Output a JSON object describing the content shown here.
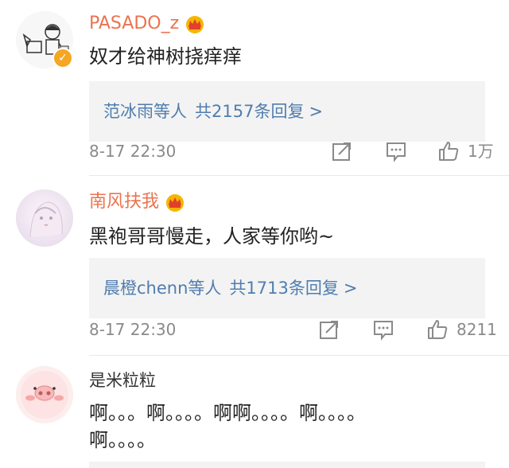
{
  "comments": [
    {
      "username": "PASADO_z",
      "text": "奴才给神树挠痒痒",
      "replies": {
        "people": "范冰雨等人",
        "count": "共2157条回复",
        "chevron": ">"
      },
      "time": "8-17 22:30",
      "likes": "1万"
    },
    {
      "username": "南风扶我",
      "text": "黑袍哥哥慢走，人家等你哟~",
      "replies": {
        "people": "晨橙chenn等人",
        "count": "共1713条回复",
        "chevron": ">"
      },
      "time": "8-17 22:30",
      "likes": "8211"
    },
    {
      "username": "是米粒粒",
      "text_line1": "啊。。。啊。。。。啊啊。。。。啊。。。。",
      "text_line2": "啊。。。。"
    }
  ],
  "icons": {
    "share": "share-icon",
    "comment": "comment-icon",
    "like": "thumbs-up-icon",
    "crown": "vip-crown-icon",
    "verified": "verified-badge-icon"
  },
  "colors": {
    "vip_name": "#eb7350",
    "link": "#507daf",
    "meta": "#8a8a8a",
    "reply_bg": "#f3f3f3",
    "verified": "#f5a623"
  }
}
